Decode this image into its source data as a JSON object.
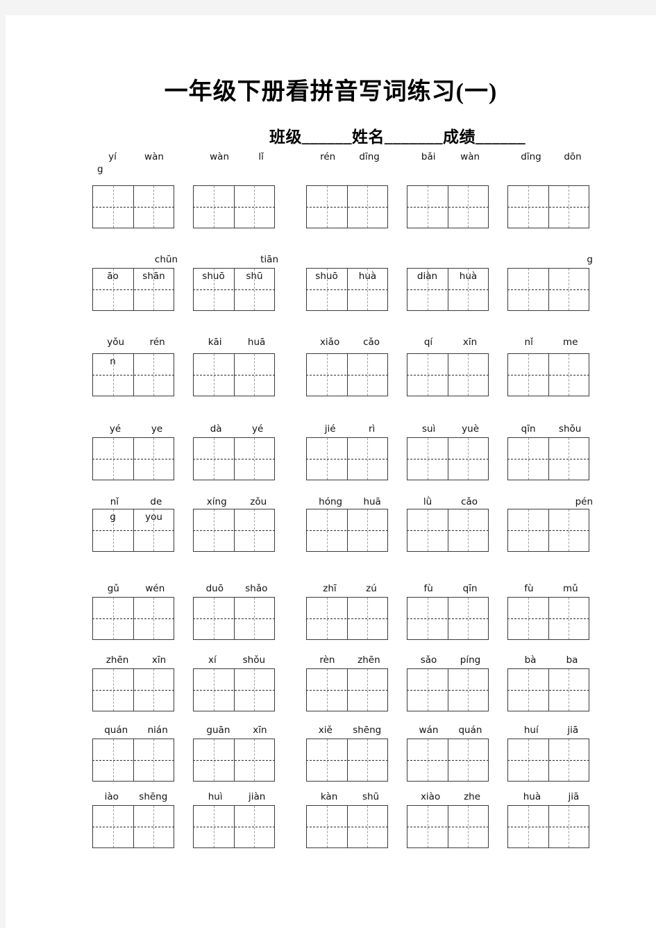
{
  "page": {
    "title": "一年级下册看拼音写词练习(一)",
    "subtitle": "班级______姓名_______成绩______",
    "paper_color": "#ffffff",
    "margin_color": "#f4f4f4",
    "ink_color": "#000000",
    "grid_line_color": "#3a3a3a",
    "guide_line_color": "#9a9a9a"
  },
  "worksheet": {
    "columns": 5,
    "rows": 9,
    "cell_type": "tian-zi-ge-two-cell",
    "items": [
      {
        "r": 0,
        "c": 0,
        "syllables": [
          "yí",
          "wàn"
        ],
        "overflow": "g",
        "style": "wrapped"
      },
      {
        "r": 0,
        "c": 1,
        "syllables": [
          "wàn",
          "lǐ"
        ],
        "overflow": "",
        "style": "normal"
      },
      {
        "r": 0,
        "c": 2,
        "syllables": [
          "rén",
          "dīng"
        ],
        "overflow": "",
        "style": "normal"
      },
      {
        "r": 0,
        "c": 3,
        "syllables": [
          "bǎi",
          "wàn"
        ],
        "overflow": "",
        "style": "normal"
      },
      {
        "r": 0,
        "c": 4,
        "syllables": [
          "dīng",
          "dōn"
        ],
        "overflow": "",
        "style": "normal"
      },
      {
        "r": 1,
        "c": 0,
        "syllables": [
          "chūn"
        ],
        "inbox": [
          "āo",
          "shān"
        ],
        "style": "inbox-single-label"
      },
      {
        "r": 1,
        "c": 1,
        "syllables": [
          "tiān"
        ],
        "inbox": [
          "shuō",
          "shū"
        ],
        "style": "inbox-single-label"
      },
      {
        "r": 1,
        "c": 2,
        "syllables": [],
        "inbox": [
          "shuō",
          "huà"
        ],
        "style": "inbox-only"
      },
      {
        "r": 1,
        "c": 3,
        "syllables": [],
        "inbox": [
          "diàn",
          "huà"
        ],
        "style": "inbox-only"
      },
      {
        "r": 1,
        "c": 4,
        "syllables": [
          "g"
        ],
        "inbox": [],
        "style": "label-right-only"
      },
      {
        "r": 2,
        "c": 0,
        "syllables": [
          "yǒu",
          "rén"
        ],
        "inbox": [
          "n",
          ""
        ],
        "style": "inbox-overflow"
      },
      {
        "r": 2,
        "c": 1,
        "syllables": [
          "kāi",
          "huā"
        ],
        "overflow": "",
        "style": "normal"
      },
      {
        "r": 2,
        "c": 2,
        "syllables": [
          "xiǎo",
          "cǎo"
        ],
        "overflow": "",
        "style": "normal"
      },
      {
        "r": 2,
        "c": 3,
        "syllables": [
          "qí",
          "xīn"
        ],
        "overflow": "",
        "style": "normal"
      },
      {
        "r": 2,
        "c": 4,
        "syllables": [
          "nǐ",
          "me"
        ],
        "overflow": "",
        "style": "normal"
      },
      {
        "r": 3,
        "c": 0,
        "syllables": [
          "yé",
          "ye"
        ],
        "overflow": "",
        "style": "normal"
      },
      {
        "r": 3,
        "c": 1,
        "syllables": [
          "dà",
          "yé"
        ],
        "overflow": "",
        "style": "normal"
      },
      {
        "r": 3,
        "c": 2,
        "syllables": [
          "jié",
          "rì"
        ],
        "overflow": "",
        "style": "normal"
      },
      {
        "r": 3,
        "c": 3,
        "syllables": [
          "suì",
          "yuè"
        ],
        "overflow": "",
        "style": "normal"
      },
      {
        "r": 3,
        "c": 4,
        "syllables": [
          "qīn",
          "shǒu"
        ],
        "overflow": "",
        "style": "normal"
      },
      {
        "r": 4,
        "c": 0,
        "syllables": [
          "nǐ",
          "de"
        ],
        "inbox": [
          "g",
          "you"
        ],
        "style": "inbox-overflow"
      },
      {
        "r": 4,
        "c": 1,
        "syllables": [
          "xíng",
          "zǒu"
        ],
        "overflow": "",
        "style": "normal"
      },
      {
        "r": 4,
        "c": 2,
        "syllables": [
          "hóng",
          "huā"
        ],
        "overflow": "",
        "style": "normal"
      },
      {
        "r": 4,
        "c": 3,
        "syllables": [
          "lǜ",
          "cǎo"
        ],
        "overflow": "",
        "style": "normal"
      },
      {
        "r": 4,
        "c": 4,
        "syllables": [
          "pén"
        ],
        "overflow": "",
        "style": "label-right-only"
      },
      {
        "r": 5,
        "c": 0,
        "syllables": [
          "gǔ",
          "wén"
        ],
        "overflow": "",
        "style": "normal"
      },
      {
        "r": 5,
        "c": 1,
        "syllables": [
          "duō",
          "shǎo"
        ],
        "overflow": "",
        "style": "normal"
      },
      {
        "r": 5,
        "c": 2,
        "syllables": [
          "zhī",
          "zú"
        ],
        "overflow": "",
        "style": "normal"
      },
      {
        "r": 5,
        "c": 3,
        "syllables": [
          "fù",
          "qīn"
        ],
        "overflow": "",
        "style": "normal"
      },
      {
        "r": 5,
        "c": 4,
        "syllables": [
          "fù",
          "mǔ"
        ],
        "overflow": "",
        "style": "normal"
      },
      {
        "r": 6,
        "c": 0,
        "syllables": [
          "zhēn",
          "xīn"
        ],
        "overflow": "",
        "style": "normal"
      },
      {
        "r": 6,
        "c": 1,
        "syllables": [
          "xí",
          "shǒu"
        ],
        "overflow": "",
        "style": "normal"
      },
      {
        "r": 6,
        "c": 2,
        "syllables": [
          "rèn",
          "zhēn"
        ],
        "overflow": "",
        "style": "normal"
      },
      {
        "r": 6,
        "c": 3,
        "syllables": [
          "sǎo",
          "píng"
        ],
        "overflow": "",
        "style": "normal"
      },
      {
        "r": 6,
        "c": 4,
        "syllables": [
          "bà",
          "ba"
        ],
        "overflow": "",
        "style": "normal"
      },
      {
        "r": 7,
        "c": 0,
        "syllables": [
          "quán",
          "nián"
        ],
        "overflow": "",
        "style": "normal"
      },
      {
        "r": 7,
        "c": 1,
        "syllables": [
          "guān",
          "xīn"
        ],
        "overflow": "",
        "style": "normal"
      },
      {
        "r": 7,
        "c": 2,
        "syllables": [
          "xiě",
          "shēng"
        ],
        "overflow": "",
        "style": "normal"
      },
      {
        "r": 7,
        "c": 3,
        "syllables": [
          "wán",
          "quán"
        ],
        "overflow": "",
        "style": "normal"
      },
      {
        "r": 7,
        "c": 4,
        "syllables": [
          "huí",
          "jiā"
        ],
        "overflow": "",
        "style": "normal"
      },
      {
        "r": 8,
        "c": 0,
        "syllables": [
          "iào",
          "shēng"
        ],
        "overflow": "",
        "style": "normal"
      },
      {
        "r": 8,
        "c": 1,
        "syllables": [
          "huì",
          "jiàn"
        ],
        "overflow": "",
        "style": "normal"
      },
      {
        "r": 8,
        "c": 2,
        "syllables": [
          "kàn",
          "shū"
        ],
        "overflow": "",
        "style": "normal"
      },
      {
        "r": 8,
        "c": 3,
        "syllables": [
          "xiào",
          "zhe"
        ],
        "overflow": "",
        "style": "normal"
      },
      {
        "r": 8,
        "c": 4,
        "syllables": [
          "huà",
          "jiā"
        ],
        "overflow": "",
        "style": "normal"
      }
    ]
  }
}
